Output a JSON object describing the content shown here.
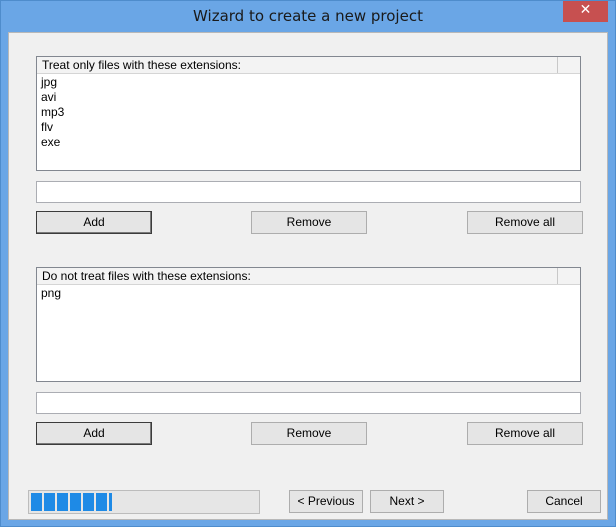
{
  "window": {
    "title": "Wizard to create a new project",
    "close_glyph": "✕"
  },
  "include_section": {
    "header": "Treat only files with these extensions:",
    "items": [
      "jpg",
      "avi",
      "mp3",
      "flv",
      "exe"
    ],
    "input_value": "",
    "add_label": "Add",
    "remove_label": "Remove",
    "remove_all_label": "Remove all"
  },
  "exclude_section": {
    "header": "Do not treat files with these extensions:",
    "items": [
      "png"
    ],
    "input_value": "",
    "add_label": "Add",
    "remove_label": "Remove",
    "remove_all_label": "Remove all"
  },
  "footer": {
    "progress_fraction": 0.36,
    "previous_label": "< Previous",
    "next_label": "Next >",
    "cancel_label": "Cancel"
  },
  "colors": {
    "titlebar": "#6aa6e6",
    "close_button": "#c75050",
    "progress_fill": "#1e8ae6"
  }
}
